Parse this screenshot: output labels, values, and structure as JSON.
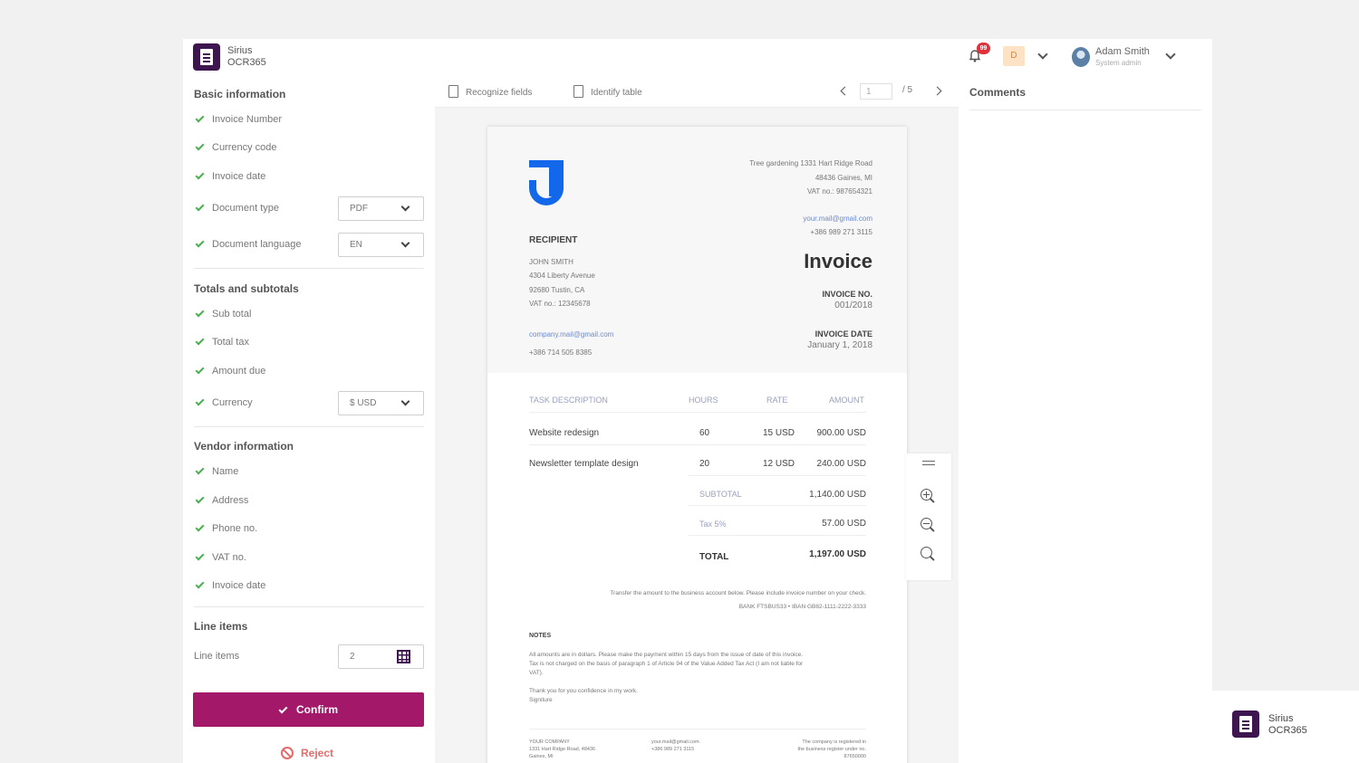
{
  "app": {
    "brand_line1": "Sirius",
    "brand_line2": "OCR365",
    "accent": "#a4186a",
    "brand_color": "#3d1650"
  },
  "header": {
    "notifications_count": "99",
    "d_badge": "D",
    "user_name": "Adam Smith",
    "user_role": "System admin"
  },
  "left": {
    "basic": {
      "title": "Basic information",
      "items": [
        "Invoice Number",
        "Currency code",
        "Invoice date",
        "Document type",
        "Document language"
      ],
      "document_type": "PDF",
      "document_language": "EN"
    },
    "totals": {
      "title": "Totals and subtotals",
      "items": [
        "Sub total",
        "Total tax",
        "Amount due",
        "Currency"
      ],
      "currency": "$ USD"
    },
    "vendor": {
      "title": "Vendor information",
      "items": [
        "Name",
        "Address",
        "Phone no.",
        "VAT no.",
        "Invoice date"
      ]
    },
    "line_items": {
      "title": "Line items",
      "label": "Line items",
      "value": "2"
    },
    "confirm_label": "Confirm",
    "reject_label": "Reject"
  },
  "toolbar": {
    "recognize_label": "Recognize fields",
    "identify_label": "Identify table",
    "page_current": "1",
    "page_total": "/ 5"
  },
  "comments": {
    "title": "Comments"
  },
  "invoice": {
    "sender_address": [
      "Tree gardening 1331 Hart Ridge Road",
      "48436 Gaines, MI",
      "VAT no.: 987654321"
    ],
    "sender_email": "your.mail@gmail.com",
    "sender_phone": "+386 989 271 3115",
    "recipient_label": "RECIPIENT",
    "recipient_lines": [
      "JOHN SMITH",
      "4304 Liberty Avenue",
      "92680 Tustin, CA",
      "VAT no.: 12345678"
    ],
    "recipient_email": "company.mail@gmail.com",
    "recipient_phone": "+386 714 505 8385",
    "title": "Invoice",
    "invoice_no_label": "INVOICE NO.",
    "invoice_no": "001/2018",
    "invoice_date_label": "INVOICE DATE",
    "invoice_date": "January 1, 2018",
    "columns": [
      "TASK DESCRIPTION",
      "HOURS",
      "RATE",
      "AMOUNT"
    ],
    "rows": [
      {
        "desc": "Website redesign",
        "hours": "60",
        "rate": "15 USD",
        "amount": "900.00 USD"
      },
      {
        "desc": "Newsletter template design",
        "hours": "20",
        "rate": "12 USD",
        "amount": "240.00 USD"
      }
    ],
    "subtotal_label": "SUBTOTAL",
    "subtotal": "1,140.00 USD",
    "tax_label": "Tax 5%",
    "tax": "57.00 USD",
    "total_label": "TOTAL",
    "total": "1,197.00 USD",
    "transfer_note": "Transfer the amount to the business account below. Please include invoice number on your check.",
    "bank_line": "BANK FTSBUS33  •  IBAN GB82-1111-2222-3333",
    "notes_label": "NOTES",
    "notes_lines": [
      "All amounts are in dollars. Please make the payment within 15 days from the issue of date of this invoice.",
      "Tax is not charged on the basis of paragraph 1 of Article 94 of the Value Added Tax Act (I am not liable for",
      "VAT).",
      "",
      "Thank you for you confidence in my work.",
      "Signiture"
    ],
    "footer_company": [
      "YOUR COMPANY",
      "1331 Hart Ridge Road, 48436",
      "Gaines, MI"
    ],
    "footer_contact": [
      "your.mail@gmail.com",
      "+386 989 271 3115"
    ],
    "footer_reg": [
      "The company is registered in",
      "the business register under no.",
      "87650000"
    ]
  },
  "icons": [
    "logo-icon",
    "bell-icon",
    "chevron-down-icon",
    "avatar",
    "check-icon",
    "dropdown-chevron-icon",
    "grid-icon",
    "reject-icon",
    "document-icon",
    "chevron-left-icon",
    "chevron-right-icon",
    "menu-icon",
    "zoom-in-icon",
    "zoom-out-icon",
    "zoom-fit-icon"
  ]
}
